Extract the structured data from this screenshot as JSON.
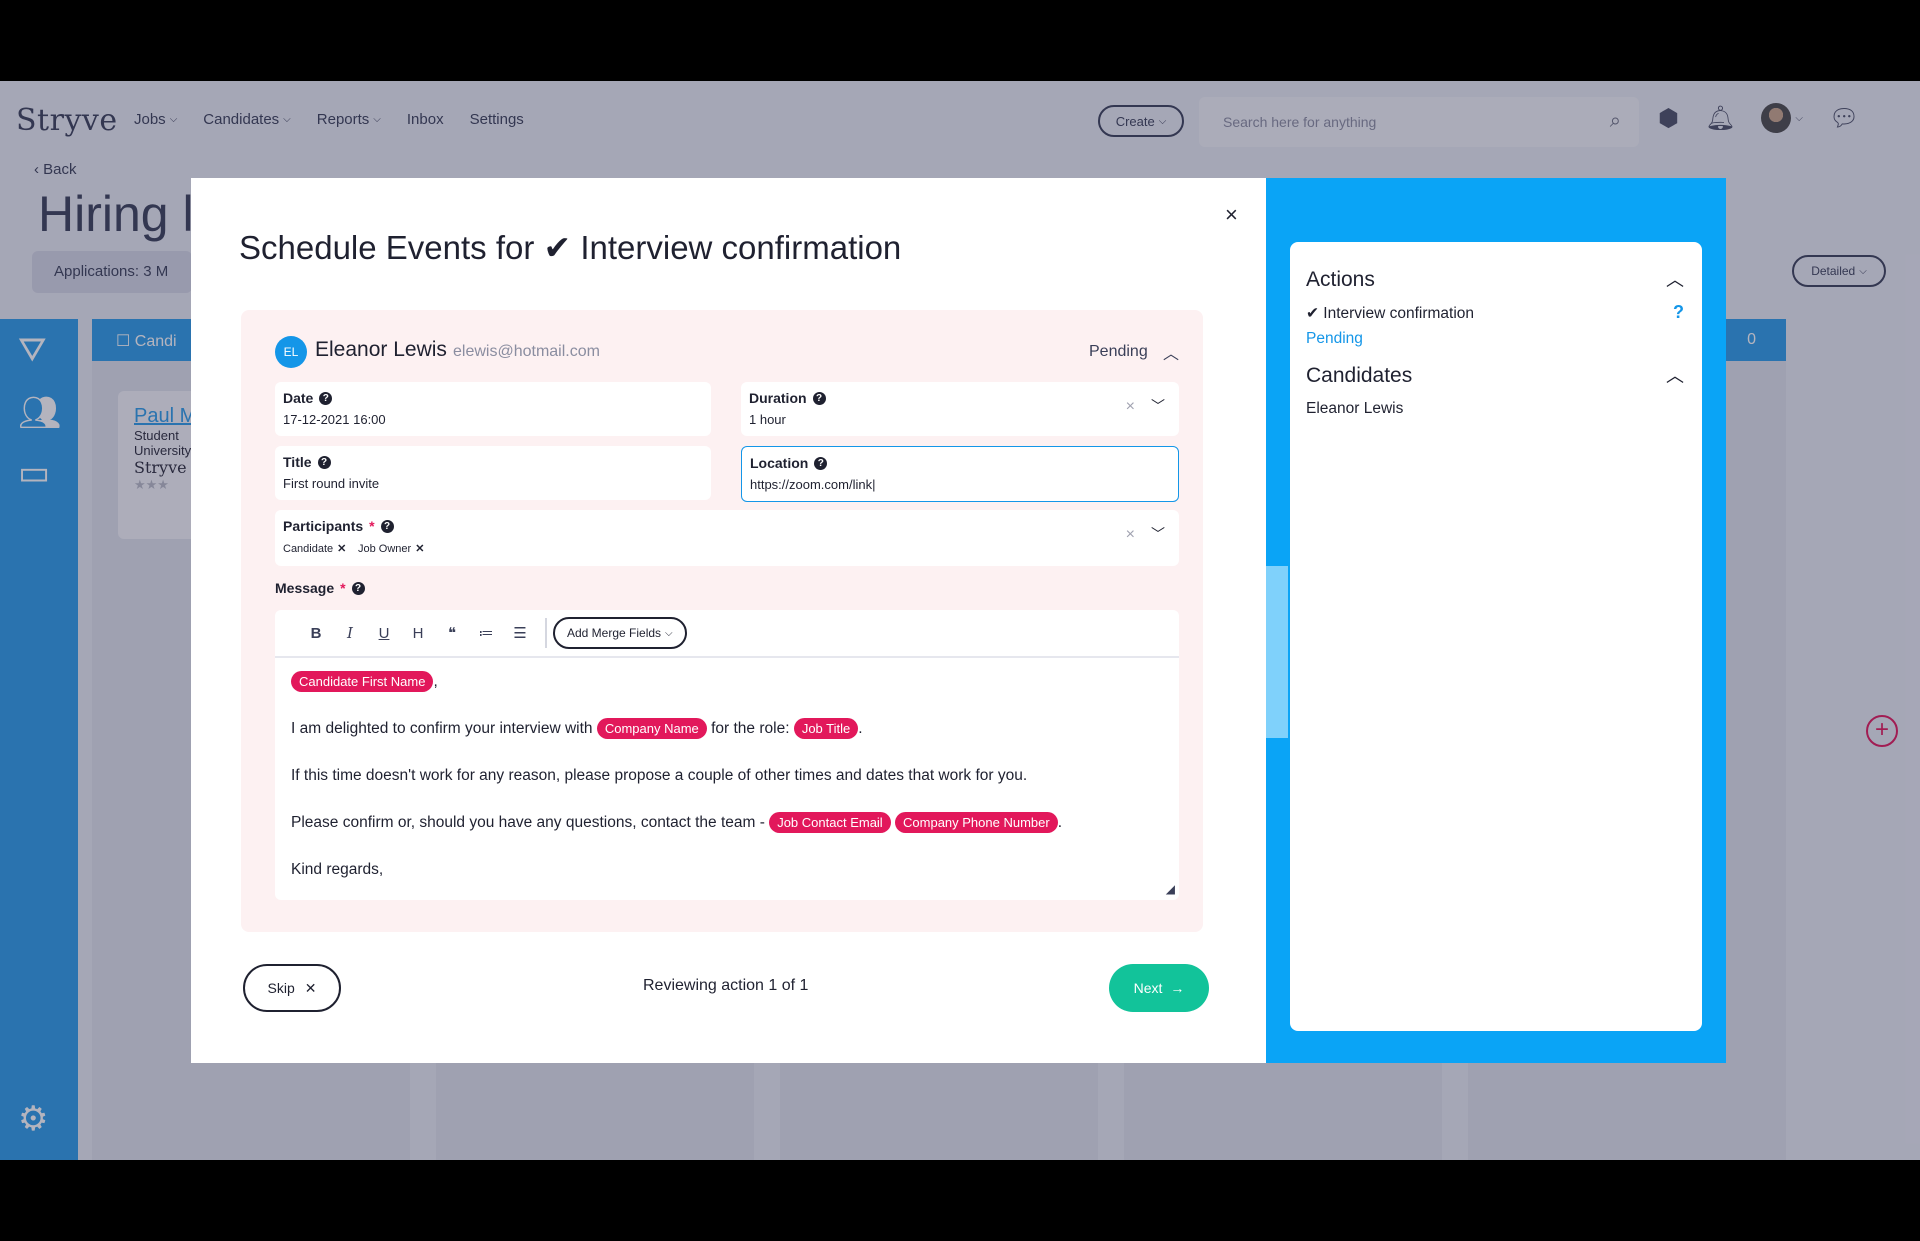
{
  "app": {
    "logo": "Stryve",
    "nav": [
      "Jobs",
      "Candidates",
      "Reports",
      "Inbox",
      "Settings"
    ],
    "create_label": "Create",
    "search_placeholder": "Search here for anything",
    "back_label": "Back",
    "page_title": "Hiring l",
    "applications_label": "Applications: 3",
    "applications_extra": "M",
    "detailed_label": "Detailed",
    "column_header": "Candi",
    "column_count": "0",
    "card": {
      "name": "Paul M",
      "line1": "Student",
      "line2": "University",
      "logo": "Stryve"
    }
  },
  "modal": {
    "title": "Schedule Events for ✔ Interview confirmation",
    "close": "×",
    "candidate": {
      "initials": "EL",
      "name": "Eleanor Lewis",
      "email": "elewis@hotmail.com",
      "status": "Pending"
    },
    "fields": {
      "date_label": "Date",
      "date_value": "17-12-2021 16:00",
      "duration_label": "Duration",
      "duration_value": "1 hour",
      "title_label": "Title",
      "title_value": "First round invite",
      "location_label": "Location",
      "location_value": "https://zoom.com/link",
      "participants_label": "Participants",
      "participants": [
        "Candidate",
        "Job Owner"
      ]
    },
    "message_label": "Message",
    "toolbar": {
      "bold": "B",
      "italic": "I",
      "underline": "U",
      "heading": "H",
      "quote": "❝",
      "ordered_list": "≔",
      "bullet_list": "☰",
      "merge_fields": "Add Merge Fields"
    },
    "message": {
      "merge_first_name": "Candidate First Name",
      "line1_suffix": ",",
      "line2_a": "I am delighted to confirm your interview with",
      "merge_company": "Company Name",
      "line2_b": "for the role:",
      "merge_job_title": "Job Title",
      "line2_end": ".",
      "line3": "If this time doesn't work for any reason, please propose a couple of other times and dates that work for you.",
      "line4_a": "Please confirm or, should you have any questions, contact the team -",
      "merge_contact_email": "Job Contact Email",
      "merge_phone": "Company Phone Number",
      "line4_end": ".",
      "line5": "Kind regards,"
    },
    "skip_label": "Skip",
    "reviewing": "Reviewing action 1 of 1",
    "next_label": "Next"
  },
  "right_panel": {
    "actions_title": "Actions",
    "action_item": "✔ Interview confirmation",
    "action_status": "Pending",
    "action_help": "?",
    "candidates_title": "Candidates",
    "candidate_item": "Eleanor Lewis"
  },
  "colors": {
    "accent_blue": "#0aa4f6",
    "merge_pink": "#e2185b",
    "next_green": "#12c39a"
  }
}
